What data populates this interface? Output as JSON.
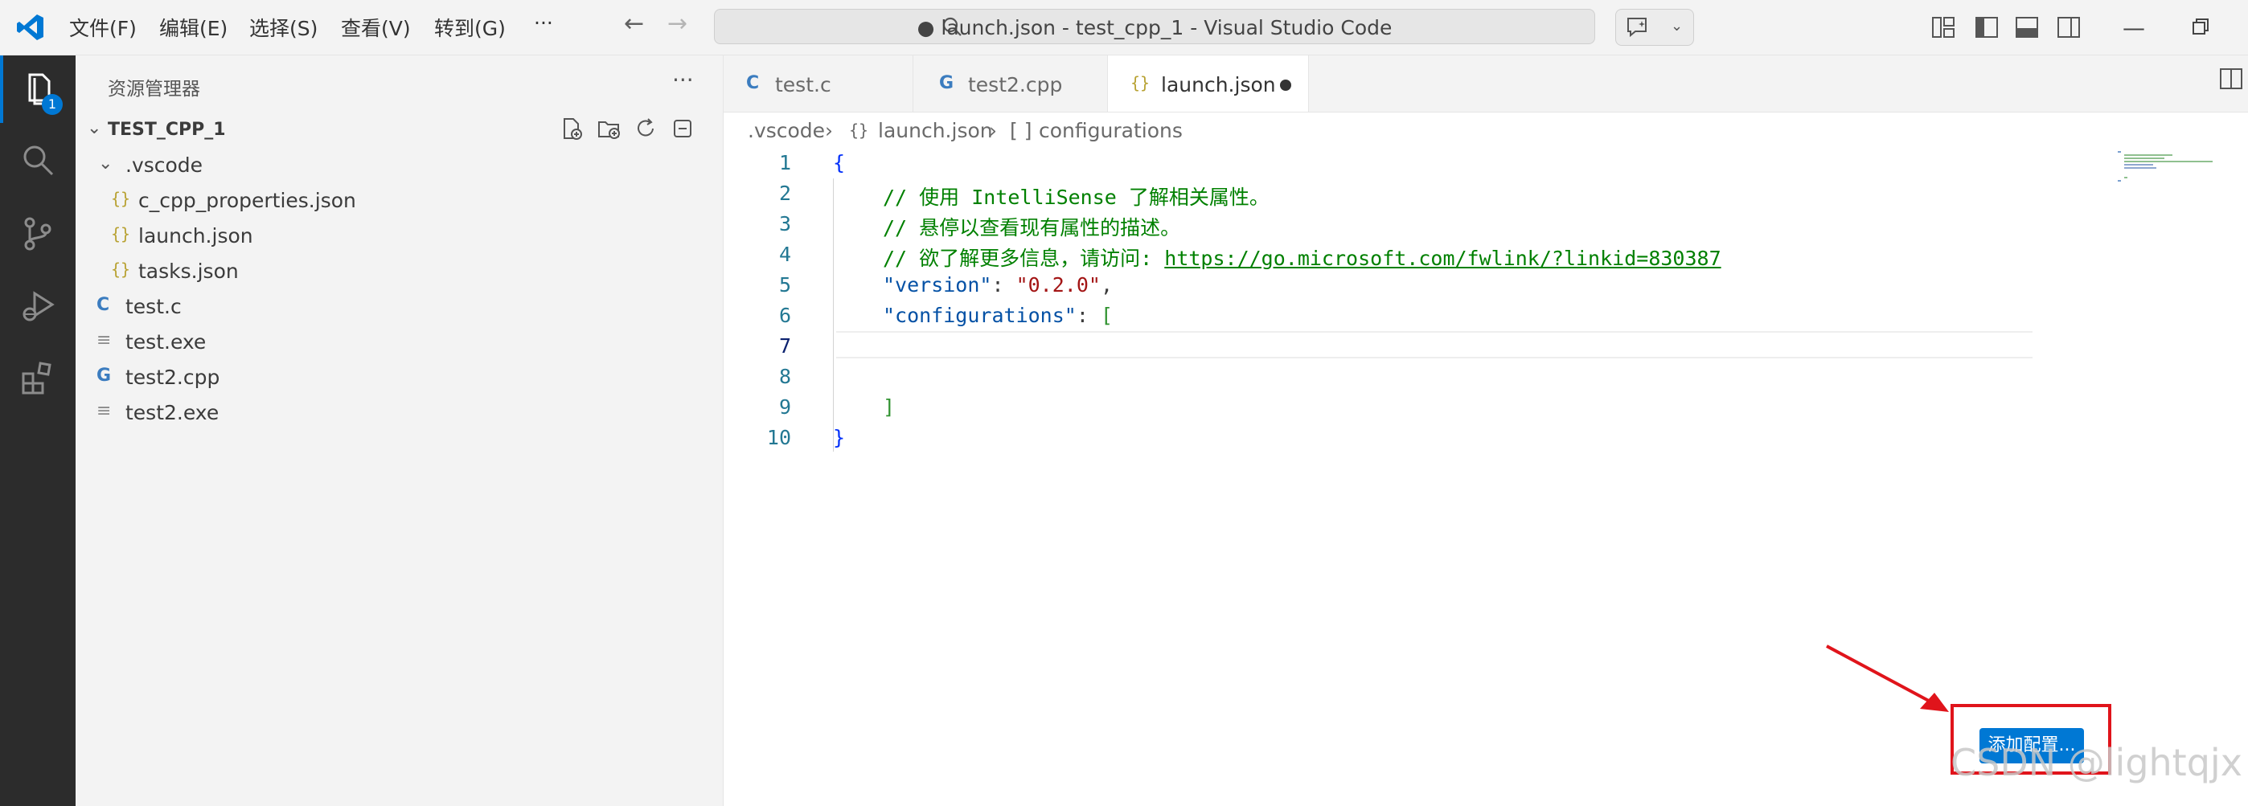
{
  "titlebar": {
    "menu": [
      "文件(F)",
      "编辑(E)",
      "选择(S)",
      "查看(V)",
      "转到(G)",
      "···"
    ],
    "search_text": "● launch.json - test_cpp_1 - Visual Studio Code"
  },
  "activitybar": {
    "explorer_badge": "1"
  },
  "sidebar": {
    "title": "资源管理器",
    "more": "···",
    "folder": "TEST_CPP_1",
    "tree": [
      {
        "label": ".vscode",
        "icon": "chevron-down-icon"
      },
      {
        "label": "c_cpp_properties.json",
        "icon": "json-icon",
        "glyph": "{}"
      },
      {
        "label": "launch.json",
        "icon": "json-icon",
        "glyph": "{}"
      },
      {
        "label": "tasks.json",
        "icon": "json-icon",
        "glyph": "{}"
      },
      {
        "label": "test.c",
        "icon": "c-file-icon",
        "glyph": "C"
      },
      {
        "label": "test.exe",
        "icon": "text-file-icon",
        "glyph": "≡"
      },
      {
        "label": "test2.cpp",
        "icon": "cpp-file-icon",
        "glyph": "G"
      },
      {
        "label": "test2.exe",
        "icon": "text-file-icon",
        "glyph": "≡"
      }
    ]
  },
  "tabs": [
    {
      "label": "test.c",
      "glyph": "C"
    },
    {
      "label": "test2.cpp",
      "glyph": "G"
    },
    {
      "label": "launch.json",
      "glyph": "{}",
      "active": true,
      "dirty": true
    }
  ],
  "breadcrumb": {
    "folder": ".vscode",
    "file_glyph": "{}",
    "file": "launch.json",
    "symbol_glyph": "[ ]",
    "symbol": "configurations"
  },
  "editor": {
    "line_numbers": [
      "1",
      "2",
      "3",
      "4",
      "5",
      "6",
      "7",
      "8",
      "9",
      "10"
    ],
    "current_line": 7,
    "lines": {
      "l1": "{",
      "l2": "// 使用 IntelliSense 了解相关属性。",
      "l3": "// 悬停以查看现有属性的描述。",
      "l4_comment": "// 欲了解更多信息，请访问: ",
      "l4_link": "https://go.microsoft.com/fwlink/?linkid=830387",
      "l5_key": "\"version\"",
      "l5_colon": ": ",
      "l5_value": "\"0.2.0\"",
      "l5_comma": ",",
      "l6_key": "\"configurations\"",
      "l6_colon": ": ",
      "l6_bracket": "[",
      "l9": "]",
      "l10": "}"
    }
  },
  "add_config_button": "添加配置...",
  "watermark": "CSDN @lightqjx",
  "colors": {
    "accent": "#0078d4",
    "annotation": "#e0141b"
  }
}
